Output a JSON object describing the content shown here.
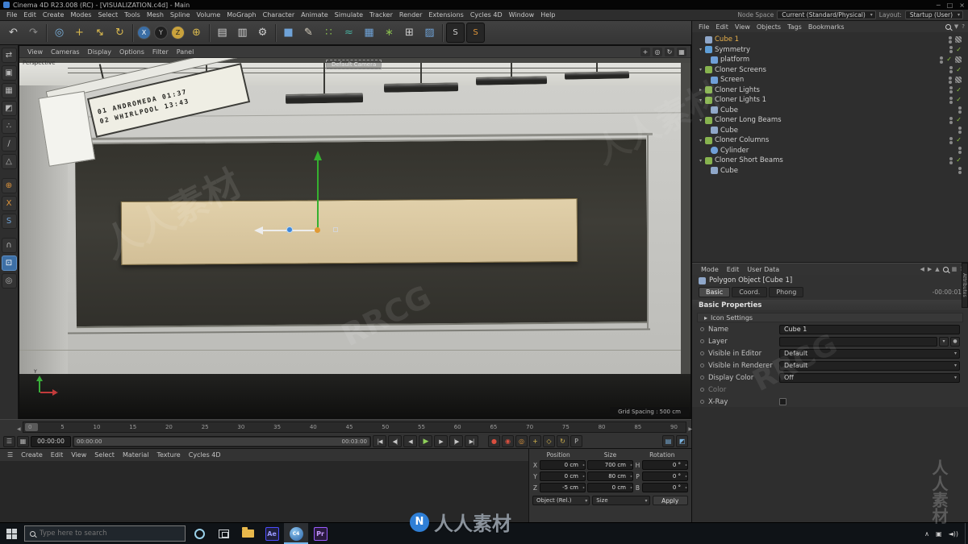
{
  "titlebar": {
    "title": "Cinema 4D R23.008 (RC) - [VISUALIZATION.c4d] - Main",
    "minimize": "─",
    "maximize": "□",
    "close": "×"
  },
  "menubar": {
    "items": [
      "File",
      "Edit",
      "Create",
      "Modes",
      "Select",
      "Tools",
      "Mesh",
      "Spline",
      "Volume",
      "MoGraph",
      "Character",
      "Animate",
      "Simulate",
      "Tracker",
      "Render",
      "Extensions",
      "Cycles 4D",
      "Window",
      "Help"
    ],
    "node_space_label": "Node Space",
    "node_space_value": "Current (Standard/Physical)",
    "layout_label": "Layout:",
    "layout_value": "Startup (User)"
  },
  "toolbar": {
    "icons": [
      {
        "name": "undo-icon",
        "glyph": "↶"
      },
      {
        "name": "redo-icon",
        "glyph": "↷"
      },
      {
        "name": "live-selection-icon",
        "glyph": "◎"
      },
      {
        "name": "move-icon",
        "glyph": "+"
      },
      {
        "name": "scale-icon",
        "glyph": "↔"
      },
      {
        "name": "rotate-icon",
        "glyph": "↻"
      },
      {
        "name": "x-axis-lock",
        "glyph": "X"
      },
      {
        "name": "y-axis-lock",
        "glyph": "Y"
      },
      {
        "name": "z-axis-lock",
        "glyph": "Z"
      },
      {
        "name": "coordinate-system-icon",
        "glyph": "⊕"
      },
      {
        "name": "render-view-icon",
        "glyph": "▤"
      },
      {
        "name": "render-picture-viewer-icon",
        "glyph": "▥"
      },
      {
        "name": "render-settings-icon",
        "glyph": "⚙"
      },
      {
        "name": "primitive-cube-icon",
        "glyph": "■"
      },
      {
        "name": "spline-pen-icon",
        "glyph": "✎"
      },
      {
        "name": "mograph-icon",
        "glyph": "∷"
      },
      {
        "name": "fields-icon",
        "glyph": "≈"
      },
      {
        "name": "volume-icon",
        "glyph": "▦"
      },
      {
        "name": "simulate-icon",
        "glyph": "∗"
      },
      {
        "name": "workplane-icon",
        "glyph": "⊞"
      },
      {
        "name": "paint-icon",
        "glyph": "▨"
      },
      {
        "name": "substance-icon",
        "glyph": "S"
      },
      {
        "name": "cycles-4d-icon",
        "glyph": "S"
      }
    ]
  },
  "side_toolbar": {
    "icons": [
      {
        "name": "convert-object-icon",
        "glyph": "⇄"
      },
      {
        "name": "model-mode-icon",
        "glyph": "▣"
      },
      {
        "name": "texture-mode-icon",
        "glyph": "▦"
      },
      {
        "name": "workplane-mode-icon",
        "glyph": "◩"
      },
      {
        "name": "points-mode-icon",
        "glyph": "∴"
      },
      {
        "name": "edges-mode-icon",
        "glyph": "∕"
      },
      {
        "name": "polygons-mode-icon",
        "glyph": "△"
      },
      {
        "name": "object-axis-icon",
        "glyph": "⊕"
      },
      {
        "name": "xparticles-icon",
        "glyph": "X"
      },
      {
        "name": "cycles-icon",
        "glyph": "S"
      },
      {
        "name": "magnet-icon",
        "glyph": "∩"
      },
      {
        "name": "snap-settings-icon",
        "glyph": "⊡"
      },
      {
        "name": "viewport-solo-icon",
        "glyph": "◎"
      }
    ]
  },
  "viewport": {
    "menus": [
      "View",
      "Cameras",
      "Display",
      "Options",
      "Filter",
      "Panel"
    ],
    "view_label": "Perspective",
    "camera_label": "Default Camera",
    "grid_spacing": "Grid Spacing : 500 cm",
    "sign_line1": "01 ANDROMEDA 01:37",
    "sign_line2": "02 WHIRLPOOL 13:43",
    "axis_x_label": "X",
    "axis_y_label": "Y",
    "header_icons": [
      {
        "name": "pan-view-icon",
        "glyph": "+"
      },
      {
        "name": "zoom-view-icon",
        "glyph": "◎"
      },
      {
        "name": "rotate-view-icon",
        "glyph": "↻"
      },
      {
        "name": "toggle-panels-icon",
        "glyph": "▦"
      }
    ]
  },
  "object_manager": {
    "menus": [
      "File",
      "Edit",
      "View",
      "Objects",
      "Tags",
      "Bookmarks"
    ],
    "header_icons": [
      {
        "name": "om-search-icon",
        "glyph": ""
      },
      {
        "name": "om-filter-icon",
        "glyph": "▼"
      },
      {
        "name": "om-help-icon",
        "glyph": "?"
      }
    ],
    "items": [
      {
        "label": "Cube 1"
      },
      {
        "label": "Symmetry"
      },
      {
        "label": "platform"
      },
      {
        "label": "Cloner Screens"
      },
      {
        "label": "Screen"
      },
      {
        "label": "Cloner Lights"
      },
      {
        "label": "Cloner Lights 1"
      },
      {
        "label": "Cube"
      },
      {
        "label": "Cloner Long Beams"
      },
      {
        "label": "Cube"
      },
      {
        "label": "Cloner Columns"
      },
      {
        "label": "Cylinder"
      },
      {
        "label": "Cloner Short Beams"
      },
      {
        "label": "Cube"
      }
    ]
  },
  "attributes": {
    "menus": [
      "Mode",
      "Edit",
      "User Data"
    ],
    "header_icons": [
      {
        "name": "back-icon",
        "glyph": "◀"
      },
      {
        "name": "forward-icon",
        "glyph": "▶"
      },
      {
        "name": "up-icon",
        "glyph": "▲"
      },
      {
        "name": "grid-icon",
        "glyph": "▦"
      },
      {
        "name": "help-icon",
        "glyph": "?"
      }
    ],
    "title": "Polygon Object [Cube 1]",
    "tabs": [
      "Basic",
      "Coord.",
      "Phong"
    ],
    "time_text": "-00:00:01",
    "section_basic": "Basic Properties",
    "icon_settings_label": "Icon Settings",
    "name_label": "Name",
    "name_value": "Cube 1",
    "layer_label": "Layer",
    "visible_editor_label": "Visible in Editor",
    "visible_editor_value": "Default",
    "visible_renderer_label": "Visible in Renderer",
    "visible_renderer_value": "Default",
    "display_color_label": "Display Color",
    "display_color_value": "Off",
    "color_label": "Color",
    "xray_label": "X-Ray",
    "panel_tab": "Attributes"
  },
  "timeline": {
    "ticks": [
      "0",
      "5",
      "10",
      "15",
      "20",
      "25",
      "30",
      "35",
      "40",
      "45",
      "50",
      "55",
      "60",
      "65",
      "70",
      "75",
      "80",
      "85",
      "90"
    ],
    "current_time": "00:00:00",
    "range_start": "00:00:00",
    "range_end": "00:03:00",
    "transport": [
      {
        "name": "goto-start-button",
        "glyph": "|◀"
      },
      {
        "name": "prev-key-button",
        "glyph": "◀|"
      },
      {
        "name": "prev-frame-button",
        "glyph": "◀"
      },
      {
        "name": "play-button",
        "glyph": "▶"
      },
      {
        "name": "next-frame-button",
        "glyph": "▶"
      },
      {
        "name": "next-key-button",
        "glyph": "|▶"
      },
      {
        "name": "goto-end-button",
        "glyph": "▶|"
      }
    ],
    "record": [
      {
        "name": "record-keyframe-button",
        "glyph": "●"
      },
      {
        "name": "autokey-button",
        "glyph": "◉"
      },
      {
        "name": "record-selected-button",
        "glyph": "◎"
      },
      {
        "name": "record-position-toggle",
        "glyph": "+"
      },
      {
        "name": "record-scale-toggle",
        "glyph": "◇"
      },
      {
        "name": "record-rotation-toggle",
        "glyph": "↻"
      },
      {
        "name": "record-parameter-toggle",
        "glyph": "P"
      }
    ]
  },
  "materials": {
    "menus": [
      "Create",
      "Edit",
      "View",
      "Select",
      "Material",
      "Texture",
      "Cycles 4D"
    ]
  },
  "coords": {
    "headers": [
      "Position",
      "Size",
      "Rotation"
    ],
    "rows": [
      {
        "axis": "X",
        "pos": "0 cm",
        "size": "700 cm",
        "rot_axis": "H",
        "rot": "0 °"
      },
      {
        "axis": "Y",
        "pos": "0 cm",
        "size": "80 cm",
        "rot_axis": "P",
        "rot": "0 °"
      },
      {
        "axis": "Z",
        "pos": "-5 cm",
        "size": "0 cm",
        "rot_axis": "B",
        "rot": "0 °"
      }
    ],
    "mode_value": "Object (Rel.)",
    "size_value": "Size",
    "apply_label": "Apply"
  },
  "taskbar": {
    "search_placeholder": "Type here to search",
    "ae_label": "Ae",
    "c4d_label": "C4",
    "pr_label": "Pr",
    "tray_caret": "∧",
    "tray_net": "▣",
    "tray_vol": "◄))"
  },
  "watermarks": {
    "site": "人人素材",
    "brand": "RRCG",
    "logo_letter": "N"
  }
}
